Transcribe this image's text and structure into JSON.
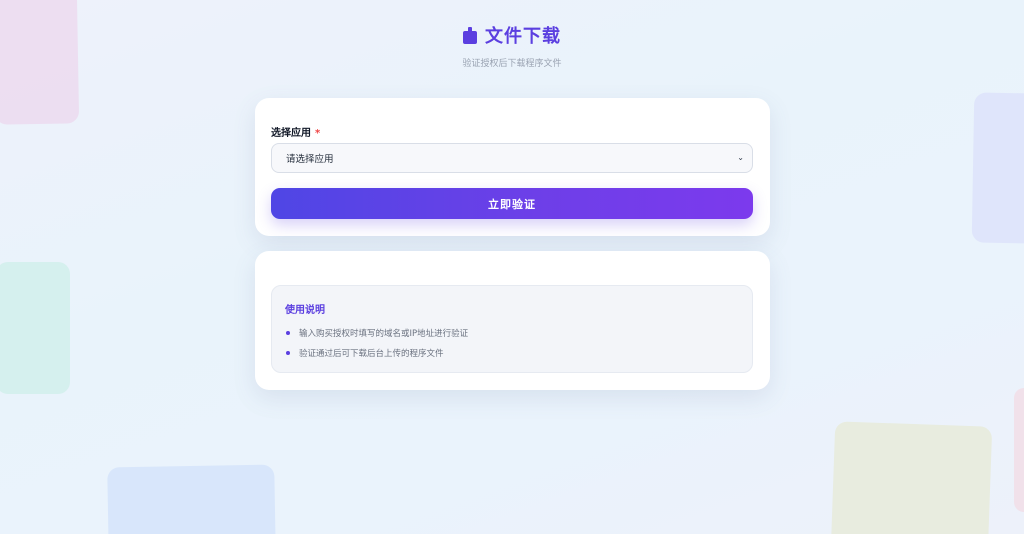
{
  "header": {
    "icon": "clipboard-icon",
    "title": "文件下载",
    "subtitle": "验证授权后下载程序文件"
  },
  "form": {
    "app_label": "选择应用",
    "required_mark": "*",
    "select_placeholder": "请选择应用",
    "verify_button": "立即验证"
  },
  "instructions": {
    "title": "使用说明",
    "items": [
      "输入购买授权时填写的域名或IP地址进行验证",
      "验证通过后可下载后台上传的程序文件"
    ]
  },
  "colors": {
    "accent": "#5b3fe0",
    "button_gradient_start": "#4f46e5",
    "button_gradient_end": "#7c3aed",
    "required": "#ef4444"
  }
}
